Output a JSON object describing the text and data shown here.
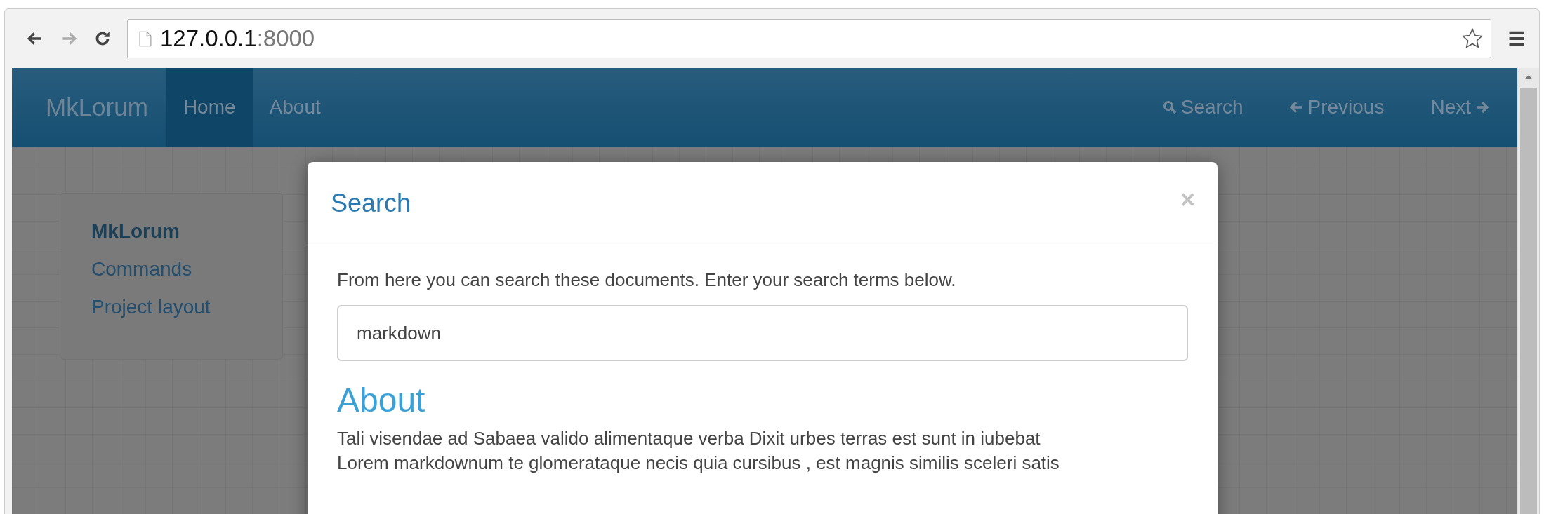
{
  "browser": {
    "url_host": "127.0.0.1",
    "url_port": ":8000"
  },
  "navbar": {
    "brand": "MkLorum",
    "items": [
      {
        "label": "Home",
        "selected": true
      },
      {
        "label": "About",
        "selected": false
      }
    ],
    "right_items": [
      {
        "kind": "search",
        "label": "Search"
      },
      {
        "kind": "previous",
        "label": "Previous"
      },
      {
        "kind": "next",
        "label": "Next"
      }
    ]
  },
  "sidebar": {
    "items": [
      {
        "label": "MkLorum",
        "selected": true
      },
      {
        "label": "Commands",
        "selected": false
      },
      {
        "label": "Project layout",
        "selected": false
      }
    ]
  },
  "modal": {
    "title": "Search",
    "close": "×",
    "intro": "From here you can search these documents. Enter your search terms below.",
    "search_field": {
      "value": "markdown"
    },
    "results": [
      {
        "title": "About",
        "lines": [
          "Tali visendae ad Sabaea valido alimentaque verba Dixit urbes terras est sunt in iubebat",
          "Lorem markdownum te glomerataque necis quia cursibus , est magnis similis sceleri satis"
        ]
      }
    ]
  }
}
